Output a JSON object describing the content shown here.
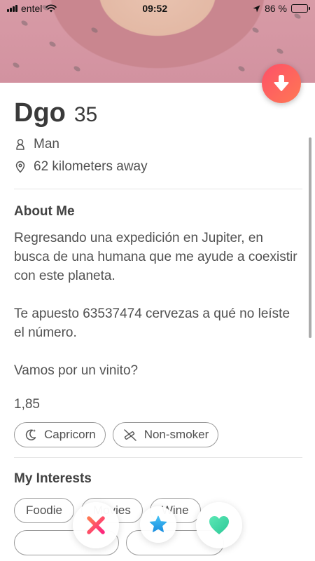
{
  "status_bar": {
    "carrier": "entel",
    "time": "09:52",
    "battery_percent": "86 %",
    "battery_level": 0.86
  },
  "profile": {
    "name": "Dgo",
    "age": "35",
    "gender": "Man",
    "distance": "62 kilometers away"
  },
  "about": {
    "title": "About Me",
    "text": "Regresando una expedición en Jupiter, en busca de una humana que me ayude a coexistir con este planeta.\n\nTe apuesto 63537474 cervezas a qué no leíste el número.\n\nVamos por un vinito?",
    "height": "1,85",
    "badges": [
      {
        "label": "Capricorn",
        "icon": "zodiac-icon"
      },
      {
        "label": "Non-smoker",
        "icon": "no-smoking-icon"
      }
    ]
  },
  "interests": {
    "title": "My Interests",
    "items": [
      "Foodie",
      "Movies",
      "Wine"
    ]
  },
  "actions": {
    "down_button_icon": "arrow-down-icon",
    "nope_icon": "x-icon",
    "super_like_icon": "star-icon",
    "like_icon": "heart-icon"
  },
  "colors": {
    "accent_gradient_start": "#fd5068",
    "accent_gradient_end": "#ff7854",
    "nope": "#fd5068",
    "super_like": "#2db5ef",
    "like": "#32e1a8"
  }
}
